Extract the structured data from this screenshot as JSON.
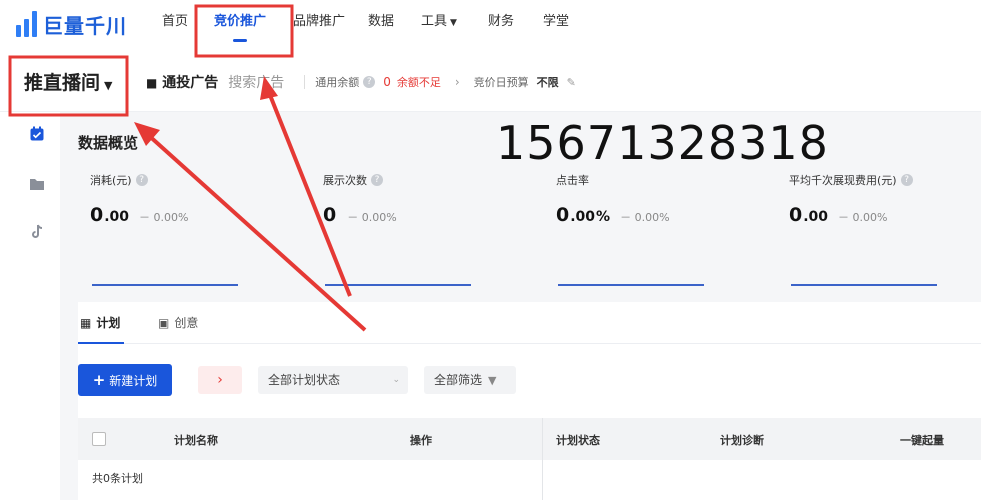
{
  "app": {
    "logo_text": "巨量千川"
  },
  "nav": {
    "items": [
      "首页",
      "竞价推广",
      "品牌推广",
      "数据",
      "工具",
      "财务",
      "学堂"
    ]
  },
  "subheader": {
    "product": "推直播间",
    "tab_active": "通投广告",
    "tab_other": "搜索广告",
    "balance_label": "通用余额",
    "balance_value": "0",
    "balance_warning": "余额不足",
    "budget_label": "竞价日预算",
    "budget_value": "不限"
  },
  "sidebar": {
    "icons": [
      "calendar-check-icon",
      "folder-icon",
      "tiktok-icon"
    ]
  },
  "overview": {
    "title": "数据概览",
    "phone": "15671328318",
    "metrics": [
      {
        "label": "消耗(元)",
        "int": "0",
        "dec": ".00",
        "unit": "",
        "delta": "－ 0.00%"
      },
      {
        "label": "展示次数",
        "int": "0",
        "dec": "",
        "unit": "",
        "delta": "－ 0.00%"
      },
      {
        "label": "点击率",
        "int": "0",
        "dec": ".00",
        "unit": " %",
        "delta": "－ 0.00%"
      },
      {
        "label": "平均千次展现费用(元)",
        "int": "0",
        "dec": ".00",
        "unit": "",
        "delta": "－ 0.00%"
      }
    ]
  },
  "tabs": {
    "plan": "计划",
    "creative": "创意"
  },
  "toolbar": {
    "new_plan": "新建计划",
    "arrow": "›",
    "status_select": "全部计划状态",
    "filter": "全部筛选"
  },
  "table": {
    "columns": [
      "计划名称",
      "操作",
      "计划状态",
      "计划诊断",
      "一键起量"
    ],
    "footer": "共0条计划"
  },
  "colors": {
    "accent": "#1a56db",
    "annotation": "#e53935"
  }
}
